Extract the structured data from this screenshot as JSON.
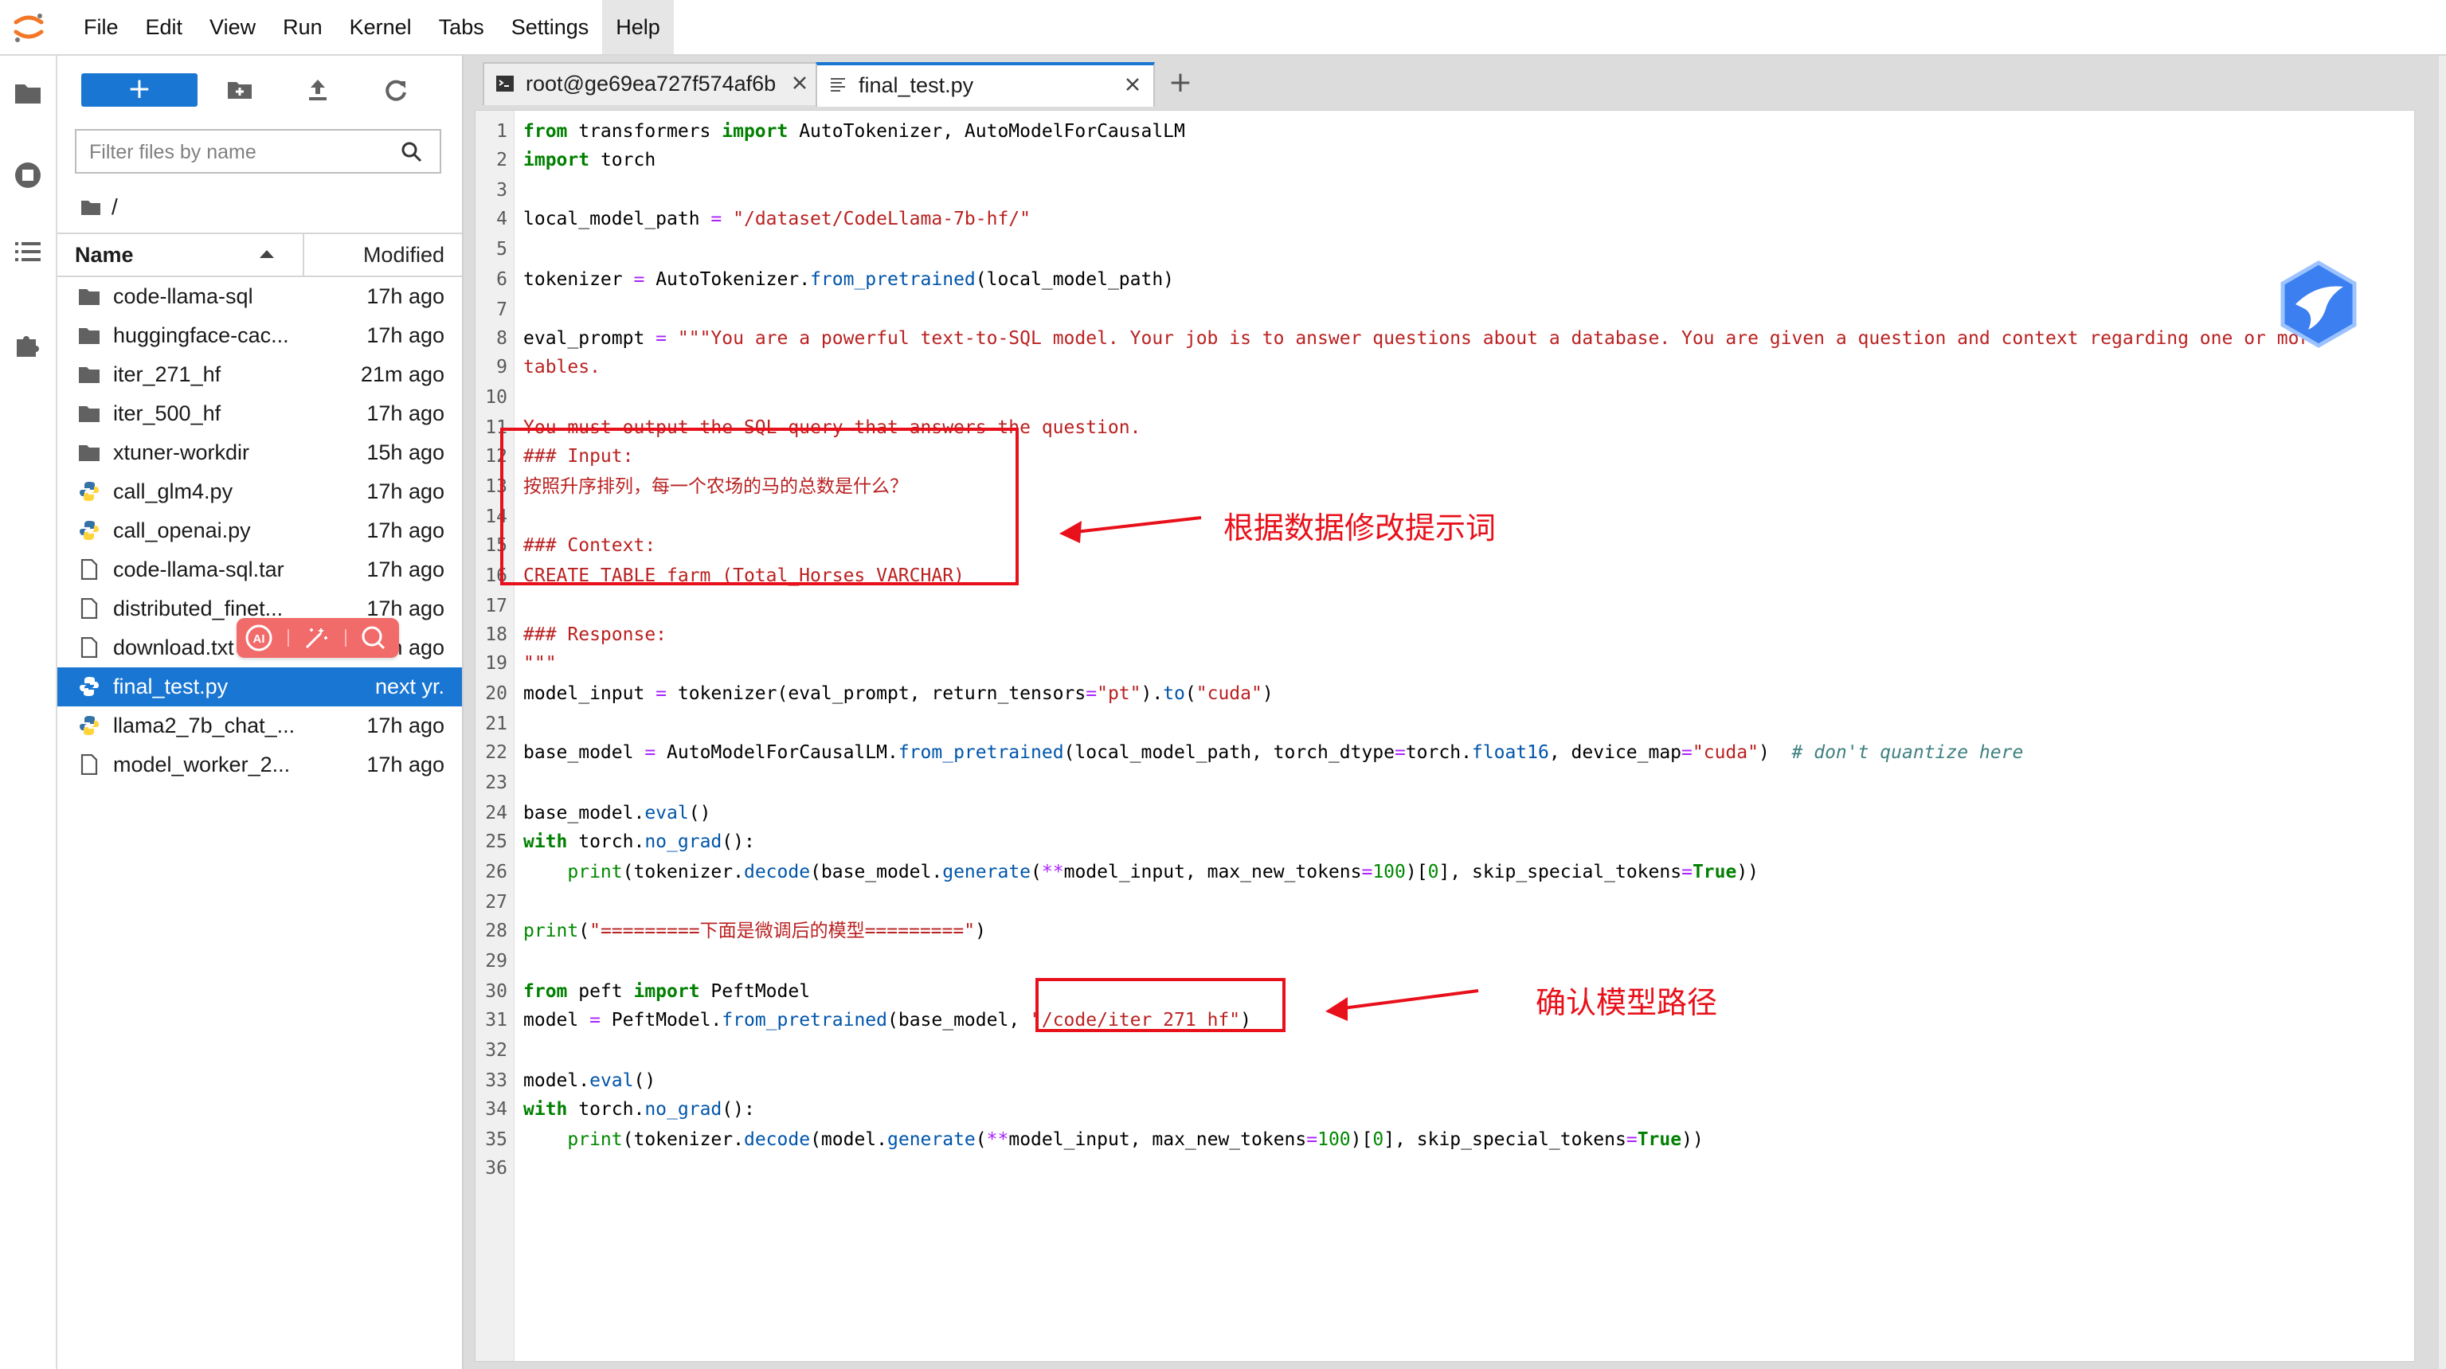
{
  "menubar": {
    "items": [
      "File",
      "Edit",
      "View",
      "Run",
      "Kernel",
      "Tabs",
      "Settings",
      "Help"
    ],
    "active": "Help"
  },
  "filebrowser": {
    "new_button": "+",
    "filter_placeholder": "Filter files by name",
    "breadcrumb": "/",
    "header": {
      "name": "Name",
      "modified": "Modified"
    },
    "files": [
      {
        "name": "code-llama-sql",
        "modified": "17h ago",
        "type": "folder"
      },
      {
        "name": "huggingface-cac...",
        "modified": "17h ago",
        "type": "folder"
      },
      {
        "name": "iter_271_hf",
        "modified": "21m ago",
        "type": "folder"
      },
      {
        "name": "iter_500_hf",
        "modified": "17h ago",
        "type": "folder"
      },
      {
        "name": "xtuner-workdir",
        "modified": "15h ago",
        "type": "folder"
      },
      {
        "name": "call_glm4.py",
        "modified": "17h ago",
        "type": "python"
      },
      {
        "name": "call_openai.py",
        "modified": "17h ago",
        "type": "python"
      },
      {
        "name": "code-llama-sql.tar",
        "modified": "17h ago",
        "type": "file"
      },
      {
        "name": "distributed_finet...",
        "modified": "17h ago",
        "type": "file"
      },
      {
        "name": "download.txt",
        "modified": "17h ago",
        "type": "file"
      },
      {
        "name": "final_test.py",
        "modified": "next yr.",
        "type": "python",
        "selected": true
      },
      {
        "name": "llama2_7b_chat_...",
        "modified": "17h ago",
        "type": "python"
      },
      {
        "name": "model_worker_2...",
        "modified": "17h ago",
        "type": "file"
      }
    ]
  },
  "tabs": [
    {
      "label": "root@ge69ea727f574af6b",
      "icon": "terminal-icon"
    },
    {
      "label": "final_test.py",
      "icon": "text-file-icon",
      "active": true
    }
  ],
  "add_tab_label": "+",
  "editor": {
    "lines": [
      "from transformers import AutoTokenizer, AutoModelForCausalLM",
      "import torch",
      "",
      "local_model_path = \"/dataset/CodeLlama-7b-hf/\"",
      "",
      "tokenizer = AutoTokenizer.from_pretrained(local_model_path)",
      "",
      "eval_prompt = \"\"\"You are a powerful text-to-SQL model. Your job is to answer questions about a database. You are given a question and context regarding one or more",
      "tables.",
      "",
      "You must output the SQL query that answers the question.",
      "### Input:",
      "按照升序排列，每一个农场的马的总数是什么？",
      "",
      "### Context:",
      "CREATE TABLE farm (Total_Horses VARCHAR)",
      "",
      "### Response:",
      "\"\"\"",
      "model_input = tokenizer(eval_prompt, return_tensors=\"pt\").to(\"cuda\")",
      "",
      "base_model = AutoModelForCausalLM.from_pretrained(local_model_path, torch_dtype=torch.float16, device_map=\"cuda\")  # don't quantize here",
      "",
      "base_model.eval()",
      "with torch.no_grad():",
      "    print(tokenizer.decode(base_model.generate(**model_input, max_new_tokens=100)[0], skip_special_tokens=True))",
      "",
      "print(\"=========下面是微调后的模型=========\")",
      "",
      "from peft import PeftModel",
      "model = PeftModel.from_pretrained(base_model, \"/code/iter_271_hf\")",
      "",
      "model.eval()",
      "with torch.no_grad():",
      "    print(tokenizer.decode(model.generate(**model_input, max_new_tokens=100)[0], skip_special_tokens=True))",
      ""
    ]
  },
  "annotations": {
    "note1": "根据数据修改提示词",
    "note2": "确认模型路径",
    "color": "#e8101a"
  },
  "colors": {
    "accent": "#1976d2",
    "keyword": "#008000",
    "string": "#ba2121",
    "function": "#0055aa",
    "operator": "#aa22ff",
    "comment": "#408080"
  }
}
